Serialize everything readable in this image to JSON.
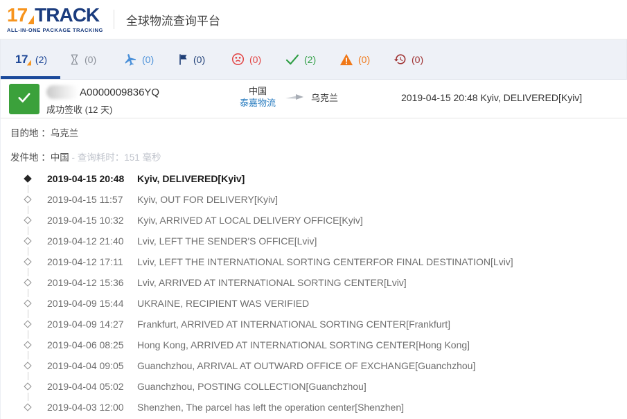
{
  "header": {
    "logo": {
      "part1": "17",
      "part2": "TRACK",
      "tagline": "ALL-IN-ONE PACKAGE TRACKING"
    },
    "site_title": "全球物流查询平台"
  },
  "tabs": [
    {
      "id": "all",
      "icon": "seventeen-logo-icon",
      "count": "(2)",
      "color": "#1c4696",
      "active": true
    },
    {
      "id": "pending",
      "icon": "hourglass-icon",
      "count": "(0)",
      "color": "#8a8f98",
      "active": false
    },
    {
      "id": "in-transit",
      "icon": "plane-icon",
      "count": "(0)",
      "color": "#4a90d9",
      "active": false
    },
    {
      "id": "pickup",
      "icon": "flag-icon",
      "count": "(0)",
      "color": "#1f3f77",
      "active": false
    },
    {
      "id": "undelivered",
      "icon": "sad-face-icon",
      "count": "(0)",
      "color": "#e24444",
      "active": false
    },
    {
      "id": "delivered",
      "icon": "check-icon",
      "count": "(2)",
      "color": "#2f9e44",
      "active": false
    },
    {
      "id": "alert",
      "icon": "warning-icon",
      "count": "(0)",
      "color": "#f07818",
      "active": false
    },
    {
      "id": "expired",
      "icon": "history-icon",
      "count": "(0)",
      "color": "#9e2f2f",
      "active": false
    }
  ],
  "package": {
    "tracking_number": "A0000009836YQ",
    "status_summary": "成功签收 (12 天)",
    "origin": "中国",
    "carrier": "泰嘉物流",
    "destination": "乌克兰",
    "last_event": "2019-04-15 20:48  Kyiv, DELIVERED[Kyiv]"
  },
  "details": {
    "destination_label": "目的地 ：",
    "destination_value": "乌克兰",
    "origin_label": "发件地 ：",
    "origin_value": "中国",
    "query_time": " - 查询耗时：151 毫秒"
  },
  "timeline": [
    {
      "time": "2019-04-15 20:48",
      "status": "Kyiv, DELIVERED[Kyiv]",
      "current": true
    },
    {
      "time": "2019-04-15 11:57",
      "status": "Kyiv, OUT FOR DELIVERY[Kyiv]",
      "current": false
    },
    {
      "time": "2019-04-15 10:32",
      "status": "Kyiv, ARRIVED AT LOCAL DELIVERY OFFICE[Kyiv]",
      "current": false
    },
    {
      "time": "2019-04-12 21:40",
      "status": "Lviv, LEFT THE SENDER'S OFFICE[Lviv]",
      "current": false
    },
    {
      "time": "2019-04-12 17:11",
      "status": "Lviv, LEFT THE INTERNATIONAL SORTING CENTERFOR FINAL DESTINATION[Lviv]",
      "current": false
    },
    {
      "time": "2019-04-12 15:36",
      "status": "Lviv, ARRIVED AT INTERNATIONAL SORTING CENTER[Lviv]",
      "current": false
    },
    {
      "time": "2019-04-09 15:44",
      "status": "UKRAINE, RECIPIENT WAS VERIFIED",
      "current": false
    },
    {
      "time": "2019-04-09 14:27",
      "status": "Frankfurt, ARRIVED AT INTERNATIONAL SORTING CENTER[Frankfurt]",
      "current": false
    },
    {
      "time": "2019-04-06 08:25",
      "status": "Hong Kong, ARRIVED AT INTERNATIONAL SORTING CENTER[Hong Kong]",
      "current": false
    },
    {
      "time": "2019-04-04 09:05",
      "status": "Guanchzhou, ARRIVAL AT OUTWARD OFFICE OF EXCHANGE[Guanchzhou]",
      "current": false
    },
    {
      "time": "2019-04-04 05:02",
      "status": "Guanchzhou, POSTING COLLECTION[Guanchzhou]",
      "current": false
    },
    {
      "time": "2019-04-03 12:00",
      "status": "Shenzhen, The parcel has left the operation center[Shenzhen]",
      "current": false
    }
  ],
  "colors": {
    "brand_orange": "#f7941d",
    "brand_navy": "#1b3c7e",
    "active_tab_underline": "#1b4a9b",
    "tabbar_background": "#eef1f7",
    "delivered_green": "#3ba13b",
    "carrier_link_blue": "#2d7fc1"
  }
}
